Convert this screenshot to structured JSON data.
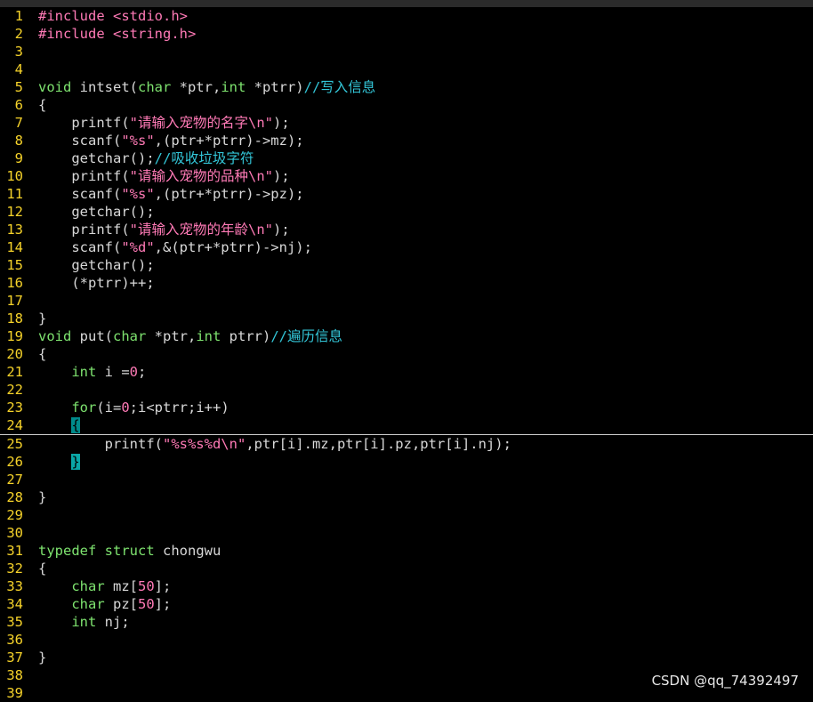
{
  "editor": {
    "lines": [
      {
        "num": "1",
        "segments": [
          [
            "#include ",
            "pp"
          ],
          [
            "<stdio.h>",
            "str"
          ]
        ]
      },
      {
        "num": "2",
        "segments": [
          [
            "#include ",
            "pp"
          ],
          [
            "<string.h>",
            "str"
          ]
        ]
      },
      {
        "num": "3",
        "segments": []
      },
      {
        "num": "4",
        "segments": []
      },
      {
        "num": "5",
        "segments": [
          [
            "void",
            "ty"
          ],
          [
            " intset(",
            "ident"
          ],
          [
            "char",
            "ty"
          ],
          [
            " *ptr,",
            "ident"
          ],
          [
            "int",
            "ty"
          ],
          [
            " *ptrr)",
            "ident"
          ],
          [
            "//写入信息",
            "cm"
          ]
        ]
      },
      {
        "num": "6",
        "segments": [
          [
            "{",
            "ident"
          ]
        ]
      },
      {
        "num": "7",
        "segments": [
          [
            "    printf(",
            "ident"
          ],
          [
            "\"请输入宠物的名字\\n\"",
            "str"
          ],
          [
            ");",
            "ident"
          ]
        ]
      },
      {
        "num": "8",
        "segments": [
          [
            "    scanf(",
            "ident"
          ],
          [
            "\"%s\"",
            "str"
          ],
          [
            ",(ptr+*ptrr)->mz);",
            "ident"
          ]
        ]
      },
      {
        "num": "9",
        "segments": [
          [
            "    getchar();",
            "ident"
          ],
          [
            "//吸收垃圾字符",
            "cm"
          ]
        ]
      },
      {
        "num": "10",
        "segments": [
          [
            "    printf(",
            "ident"
          ],
          [
            "\"请输入宠物的品种\\n\"",
            "str"
          ],
          [
            ");",
            "ident"
          ]
        ]
      },
      {
        "num": "11",
        "segments": [
          [
            "    scanf(",
            "ident"
          ],
          [
            "\"%s\"",
            "str"
          ],
          [
            ",(ptr+*ptrr)->pz);",
            "ident"
          ]
        ]
      },
      {
        "num": "12",
        "segments": [
          [
            "    getchar();",
            "ident"
          ]
        ]
      },
      {
        "num": "13",
        "segments": [
          [
            "    printf(",
            "ident"
          ],
          [
            "\"请输入宠物的年龄\\n\"",
            "str"
          ],
          [
            ");",
            "ident"
          ]
        ]
      },
      {
        "num": "14",
        "segments": [
          [
            "    scanf(",
            "ident"
          ],
          [
            "\"%d\"",
            "str"
          ],
          [
            ",&(ptr+*ptrr)->nj);",
            "ident"
          ]
        ]
      },
      {
        "num": "15",
        "segments": [
          [
            "    getchar();",
            "ident"
          ]
        ]
      },
      {
        "num": "16",
        "segments": [
          [
            "    (*ptrr)++;",
            "ident"
          ]
        ]
      },
      {
        "num": "17",
        "segments": []
      },
      {
        "num": "18",
        "segments": [
          [
            "}",
            "ident"
          ]
        ]
      },
      {
        "num": "19",
        "segments": [
          [
            "void",
            "ty"
          ],
          [
            " put(",
            "ident"
          ],
          [
            "char",
            "ty"
          ],
          [
            " *ptr,",
            "ident"
          ],
          [
            "int",
            "ty"
          ],
          [
            " ptrr)",
            "ident"
          ],
          [
            "//遍历信息",
            "cm"
          ]
        ]
      },
      {
        "num": "20",
        "segments": [
          [
            "{",
            "ident"
          ]
        ]
      },
      {
        "num": "21",
        "segments": [
          [
            "    ",
            "ident"
          ],
          [
            "int",
            "ty"
          ],
          [
            " i =",
            "ident"
          ],
          [
            "0",
            "num"
          ],
          [
            ";",
            "ident"
          ]
        ]
      },
      {
        "num": "22",
        "segments": []
      },
      {
        "num": "23",
        "segments": [
          [
            "    ",
            "ident"
          ],
          [
            "for",
            "kw"
          ],
          [
            "(i=",
            "ident"
          ],
          [
            "0",
            "num"
          ],
          [
            ";i<ptrr;i++)",
            "ident"
          ]
        ]
      },
      {
        "num": "24",
        "segments": [
          [
            "    ",
            "ident"
          ],
          [
            "{",
            "cursor"
          ]
        ],
        "cursorline": true
      },
      {
        "num": "25",
        "segments": [
          [
            "        printf(",
            "ident"
          ],
          [
            "\"%s%s%d\\n\"",
            "str"
          ],
          [
            ",ptr[i].mz,ptr[i].pz,ptr[i].nj);",
            "ident"
          ]
        ]
      },
      {
        "num": "26",
        "segments": [
          [
            "    ",
            "ident"
          ],
          [
            "}",
            "match"
          ]
        ]
      },
      {
        "num": "27",
        "segments": []
      },
      {
        "num": "28",
        "segments": [
          [
            "}",
            "ident"
          ]
        ]
      },
      {
        "num": "29",
        "segments": []
      },
      {
        "num": "30",
        "segments": []
      },
      {
        "num": "31",
        "segments": [
          [
            "typedef",
            "ty"
          ],
          [
            " ",
            "ident"
          ],
          [
            "struct",
            "ty"
          ],
          [
            " chongwu",
            "ident"
          ]
        ]
      },
      {
        "num": "32",
        "segments": [
          [
            "{",
            "ident"
          ]
        ]
      },
      {
        "num": "33",
        "segments": [
          [
            "    ",
            "ident"
          ],
          [
            "char",
            "ty"
          ],
          [
            " mz[",
            "ident"
          ],
          [
            "50",
            "num"
          ],
          [
            "];",
            "ident"
          ]
        ]
      },
      {
        "num": "34",
        "segments": [
          [
            "    ",
            "ident"
          ],
          [
            "char",
            "ty"
          ],
          [
            " pz[",
            "ident"
          ],
          [
            "50",
            "num"
          ],
          [
            "];",
            "ident"
          ]
        ]
      },
      {
        "num": "35",
        "segments": [
          [
            "    ",
            "ident"
          ],
          [
            "int",
            "ty"
          ],
          [
            " nj;",
            "ident"
          ]
        ]
      },
      {
        "num": "36",
        "segments": []
      },
      {
        "num": "37",
        "segments": [
          [
            "}",
            "ident"
          ]
        ]
      },
      {
        "num": "38",
        "segments": []
      },
      {
        "num": "39",
        "segments": []
      }
    ]
  },
  "watermark": {
    "text": "CSDN @qq_74392497"
  },
  "colors": {
    "background": "#000000",
    "line_number": "#f5d22a",
    "keyword": "#7ee36f",
    "string": "#ff7ab6",
    "comment": "#33c6d8",
    "cursor": "#008b8b"
  }
}
